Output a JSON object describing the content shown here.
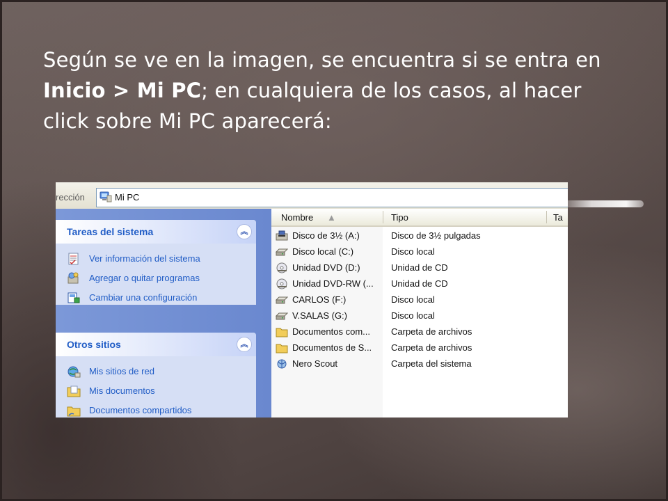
{
  "caption": {
    "part1": "Según se ve en la imagen, se encuentra si se entra en ",
    "bold1": "Inicio",
    "sep": " > ",
    "bold2": "Mi PC",
    "part2": "; en cualquiera de los casos, al hacer click sobre Mi PC  aparecerá:"
  },
  "explorer": {
    "address_label": "rección",
    "address_value": "Mi PC",
    "system_tasks": {
      "title": "Tareas del sistema",
      "items": [
        {
          "label": "Ver información del sistema",
          "icon": "system-info-icon"
        },
        {
          "label": "Agregar o quitar programas",
          "icon": "add-remove-programs-icon"
        },
        {
          "label": "Cambiar una configuración",
          "icon": "control-panel-icon"
        }
      ]
    },
    "other_places": {
      "title": "Otros sitios",
      "items": [
        {
          "label": "Mis sitios de red",
          "icon": "network-places-icon"
        },
        {
          "label": "Mis documentos",
          "icon": "my-documents-icon"
        },
        {
          "label": "Documentos compartidos",
          "icon": "shared-folder-icon"
        }
      ]
    },
    "columns": {
      "name": "Nombre",
      "type": "Tipo",
      "third": "Ta"
    },
    "rows": [
      {
        "name": "Disco de 3½ (A:)",
        "type": "Disco de 3½ pulgadas",
        "icon": "floppy-drive-icon"
      },
      {
        "name": "Disco local (C:)",
        "type": "Disco local",
        "icon": "hard-disk-icon"
      },
      {
        "name": "Unidad DVD (D:)",
        "type": "Unidad de CD",
        "icon": "dvd-drive-icon"
      },
      {
        "name": "Unidad DVD-RW (...",
        "type": "Unidad de CD",
        "icon": "dvd-drive-icon"
      },
      {
        "name": "CARLOS (F:)",
        "type": "Disco local",
        "icon": "hard-disk-icon"
      },
      {
        "name": "V.SALAS (G:)",
        "type": "Disco local",
        "icon": "hard-disk-icon"
      },
      {
        "name": "Documentos com...",
        "type": "Carpeta de archivos",
        "icon": "folder-icon"
      },
      {
        "name": "Documentos de S...",
        "type": "Carpeta de archivos",
        "icon": "folder-icon"
      },
      {
        "name": "Nero Scout",
        "type": "Carpeta del sistema",
        "icon": "nero-scout-icon"
      }
    ]
  },
  "colors": {
    "xp_blue_text": "#215dc6",
    "sidebar_blue": "#6a88cf",
    "panel_bg": "#d6dff5",
    "folder_yellow": "#f2cd5a"
  }
}
